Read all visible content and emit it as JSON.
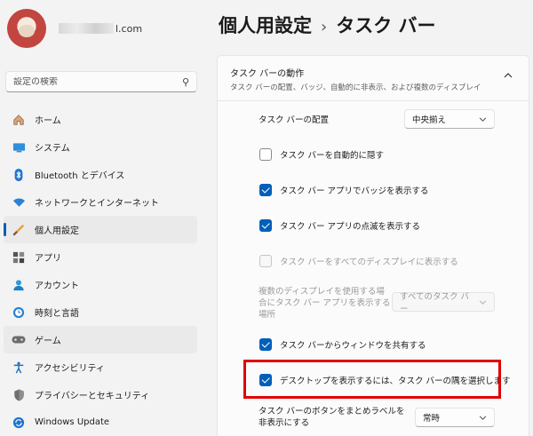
{
  "profile": {
    "email_suffix": "l.com"
  },
  "search": {
    "placeholder": "設定の検索"
  },
  "sidebar": {
    "items": [
      {
        "label": "ホーム",
        "icon": "home-icon"
      },
      {
        "label": "システム",
        "icon": "system-icon"
      },
      {
        "label": "Bluetooth とデバイス",
        "icon": "bluetooth-icon"
      },
      {
        "label": "ネットワークとインターネット",
        "icon": "network-icon"
      },
      {
        "label": "個人用設定",
        "icon": "brush-icon"
      },
      {
        "label": "アプリ",
        "icon": "apps-icon"
      },
      {
        "label": "アカウント",
        "icon": "account-icon"
      },
      {
        "label": "時刻と言語",
        "icon": "time-language-icon"
      },
      {
        "label": "ゲーム",
        "icon": "gaming-icon"
      },
      {
        "label": "アクセシビリティ",
        "icon": "accessibility-icon"
      },
      {
        "label": "プライバシーとセキュリティ",
        "icon": "shield-icon"
      },
      {
        "label": "Windows Update",
        "icon": "windows-update-icon"
      }
    ],
    "active_index": 4
  },
  "header": {
    "parent": "個人用設定",
    "separator": "›",
    "current": "タスク バー"
  },
  "section": {
    "title": "タスク バーの動作",
    "subtitle": "タスク バーの配置、バッジ、自動的に非表示、および複数のディスプレイ"
  },
  "settings": {
    "alignment_label": "タスク バーの配置",
    "alignment_value": "中央揃え",
    "auto_hide": "タスク バーを自動的に隠す",
    "badges": "タスク バー アプリでバッジを表示する",
    "flashing": "タスク バー アプリの点滅を表示する",
    "all_displays": "タスク バーをすべてのディスプレイに表示する",
    "multi_display_line1": "複数のディスプレイを使用する場",
    "multi_display_line2": "合にタスク バー アプリを表示する",
    "multi_display_line3": "場所",
    "multi_display_value": "すべてのタスク バー",
    "share_window": "タスク バーからウィンドウを共有する",
    "far_corner": "デスクトップを表示するには、タスク バーの隅を選択します",
    "combine_line1": "タスク バーのボタンをまとめラベルを",
    "combine_line2": "非表示にする",
    "combine_value": "常時"
  },
  "colors": {
    "accent": "#005fb8",
    "highlight": "#e00000"
  }
}
